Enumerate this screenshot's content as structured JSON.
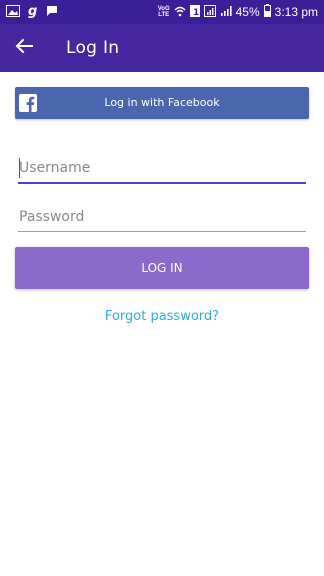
{
  "status_bar": {
    "network_label_top": "VoG",
    "network_label_bottom": "LTE",
    "battery_percent": "45%",
    "time": "3:13 pm"
  },
  "app_bar": {
    "title": "Log In"
  },
  "facebook_button": {
    "label": "Log in with Facebook"
  },
  "form": {
    "username_placeholder": "Username",
    "password_placeholder": "Password",
    "login_label": "LOG IN",
    "forgot_label": "Forgot password?"
  },
  "colors": {
    "status_bar": "#3a1f99",
    "app_bar": "#4527a0",
    "facebook": "#4a67ad",
    "login_button": "#8a6bcc",
    "link": "#2ab0d9",
    "focus_underline": "#5b3cc4"
  }
}
